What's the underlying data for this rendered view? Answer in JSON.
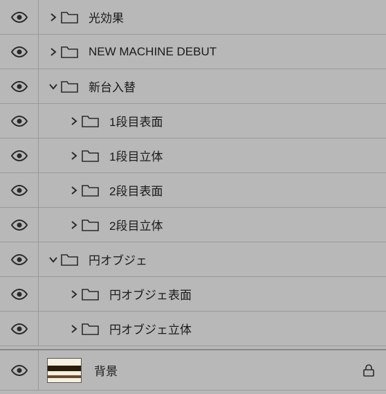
{
  "layers": [
    {
      "id": "light-effects",
      "label": "光効果",
      "indent": 0,
      "expanded": false,
      "type": "folder",
      "visible": true,
      "locked": false
    },
    {
      "id": "new-machine",
      "label": "NEW MACHINE DEBUT",
      "indent": 0,
      "expanded": false,
      "type": "folder",
      "visible": true,
      "locked": false
    },
    {
      "id": "shindai-irekae",
      "label": "新台入替",
      "indent": 0,
      "expanded": true,
      "type": "folder",
      "visible": true,
      "locked": false
    },
    {
      "id": "row1-surface",
      "label": "1段目表面",
      "indent": 1,
      "expanded": false,
      "type": "folder",
      "visible": true,
      "locked": false
    },
    {
      "id": "row1-3d",
      "label": "1段目立体",
      "indent": 1,
      "expanded": false,
      "type": "folder",
      "visible": true,
      "locked": false
    },
    {
      "id": "row2-surface",
      "label": "2段目表面",
      "indent": 1,
      "expanded": false,
      "type": "folder",
      "visible": true,
      "locked": false
    },
    {
      "id": "row2-3d",
      "label": "2段目立体",
      "indent": 1,
      "expanded": false,
      "type": "folder",
      "visible": true,
      "locked": false
    },
    {
      "id": "circle-obj",
      "label": "円オブジェ",
      "indent": 0,
      "expanded": true,
      "type": "folder",
      "visible": true,
      "locked": false
    },
    {
      "id": "circle-surface",
      "label": "円オブジェ表面",
      "indent": 1,
      "expanded": false,
      "type": "folder",
      "visible": true,
      "locked": false
    },
    {
      "id": "circle-3d",
      "label": "円オブジェ立体",
      "indent": 1,
      "expanded": false,
      "type": "folder",
      "visible": true,
      "locked": false
    },
    {
      "id": "background",
      "label": "背景",
      "indent": 0,
      "expanded": null,
      "type": "image",
      "visible": true,
      "locked": true
    }
  ],
  "icons": {
    "eye": "visibility-icon",
    "folder": "folder-icon",
    "chevron_right": "chevron-right-icon",
    "chevron_down": "chevron-down-icon",
    "lock": "lock-icon"
  },
  "colors": {
    "panel_bg": "#b8b8b8",
    "row_border": "#999999",
    "text": "#1a1a1a"
  }
}
